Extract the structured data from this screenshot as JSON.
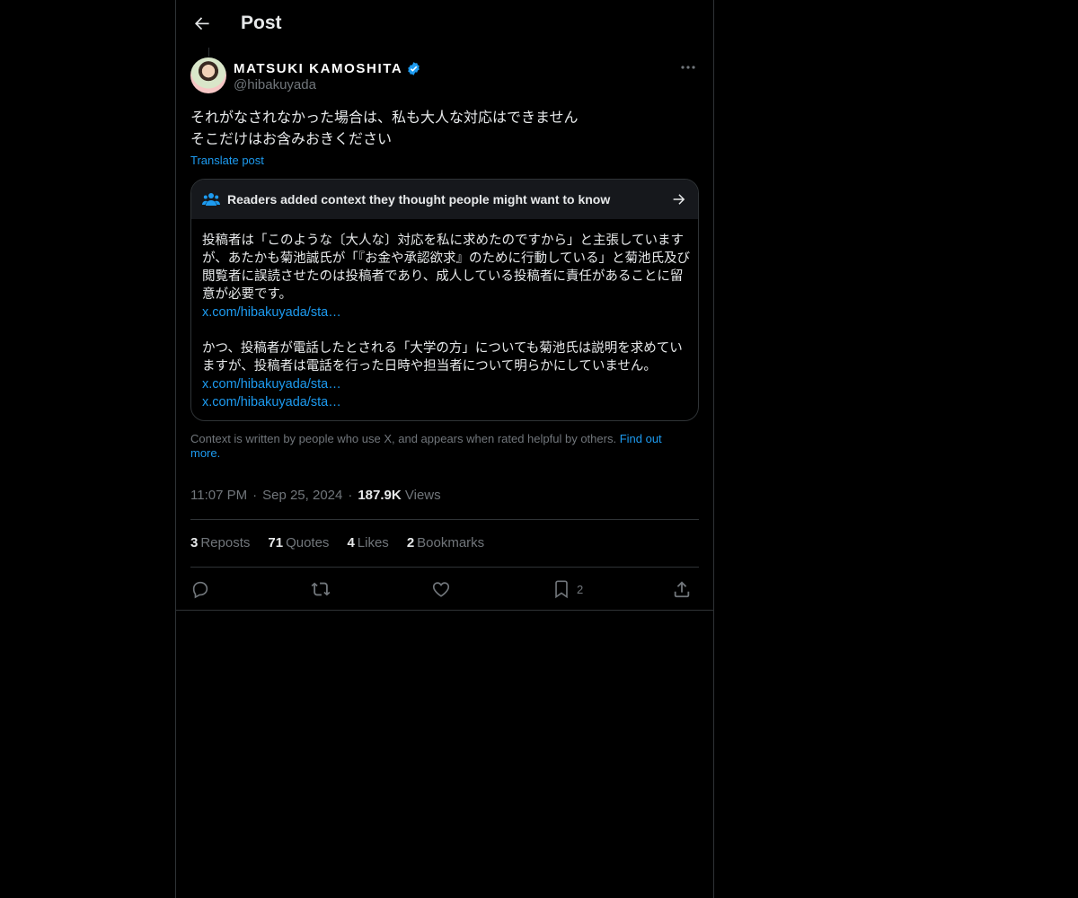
{
  "header": {
    "title": "Post"
  },
  "author": {
    "display_name": "MATSUKI KAMOSHITA",
    "handle": "@hibakuyada"
  },
  "tweet": {
    "text": "それがなされなかった場合は、私も大人な対応はできません\nそこだけはお含みおきください",
    "translate_label": "Translate post"
  },
  "community_note": {
    "title": "Readers added context they thought people might want to know",
    "paragraph1": "投稿者は「このような〔大人な〕対応を私に求めたのですから」と主張していますが、あたかも菊池誠氏が「『お金や承認欲求』のために行動している」と菊池氏及び閲覧者に誤読させたのは投稿者であり、成人している投稿者に責任があることに留意が必要です。",
    "link1": "x.com/hibakuyada/sta…",
    "paragraph2": "かつ、投稿者が電話したとされる「大学の方」についても菊池氏は説明を求めていますが、投稿者は電話を行った日時や担当者について明らかにしていません。",
    "link2": "x.com/hibakuyada/sta…",
    "link3": "x.com/hibakuyada/sta…"
  },
  "disclaimer": {
    "text": "Context is written by people who use X, and appears when rated helpful by others.",
    "find_out": "Find out more."
  },
  "meta": {
    "time": "11:07 PM",
    "date": "Sep 25, 2024",
    "views_count": "187.9K",
    "views_label": "Views"
  },
  "stats": {
    "reposts_count": "3",
    "reposts_label": "Reposts",
    "quotes_count": "71",
    "quotes_label": "Quotes",
    "likes_count": "4",
    "likes_label": "Likes",
    "bookmarks_count": "2",
    "bookmarks_label": "Bookmarks"
  },
  "actions": {
    "bookmark_count": "2"
  },
  "colors": {
    "accent": "#1d9bf0",
    "muted": "#71767b",
    "border": "#2f3336",
    "text": "#e7e9ea"
  },
  "icons": [
    "back-arrow-icon",
    "verified-badge-icon",
    "more-icon",
    "people-icon",
    "arrow-right-icon",
    "reply-icon",
    "repost-icon",
    "like-icon",
    "bookmark-icon",
    "share-icon"
  ]
}
